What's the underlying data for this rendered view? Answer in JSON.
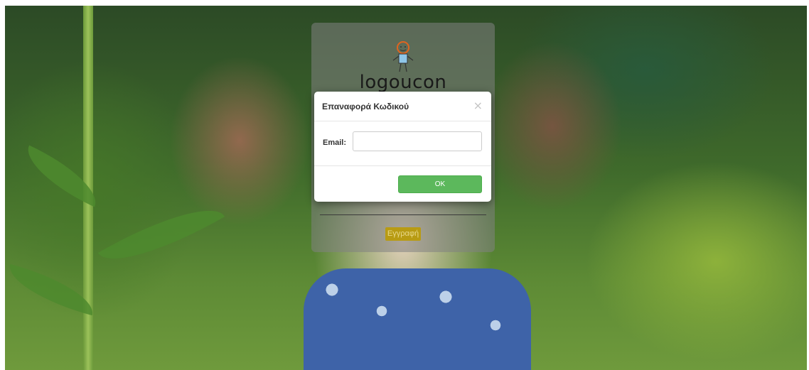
{
  "login_card": {
    "logo_text": "logoucon",
    "register_label": "Εγγραφή"
  },
  "modal": {
    "title": "Επαναφορά Κωδικού",
    "close_symbol": "×",
    "email_label": "Email:",
    "email_value": "",
    "ok_label": "OK"
  },
  "colors": {
    "ok_button": "#5cb85c",
    "register_button": "#b89b13"
  },
  "icons": {
    "logo": "child-figure-logo-icon",
    "close": "close-icon"
  }
}
